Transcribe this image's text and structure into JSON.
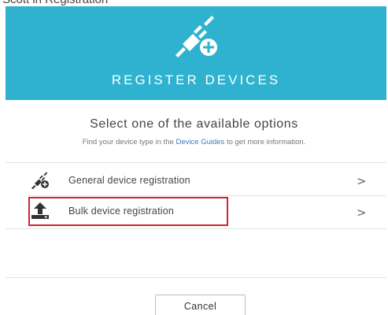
{
  "top_caption": "Scott in Registration",
  "header": {
    "title": "REGISTER DEVICES",
    "icon": "plug-add-icon",
    "background_color": "#2fb2cf"
  },
  "intro": {
    "subtitle": "Select one of the available options",
    "hint_prefix": "Find your device type in the ",
    "hint_link": "Device Guides",
    "hint_suffix": " to get more information.",
    "link_color": "#3a7dbd"
  },
  "options": [
    {
      "label": "General device registration",
      "icon": "plug-add-icon",
      "chevron": ">"
    },
    {
      "label": "Bulk device registration",
      "icon": "upload-icon",
      "chevron": ">",
      "highlighted": true,
      "highlight_color": "#d3242b"
    }
  ],
  "footer": {
    "cancel_label": "Cancel"
  }
}
